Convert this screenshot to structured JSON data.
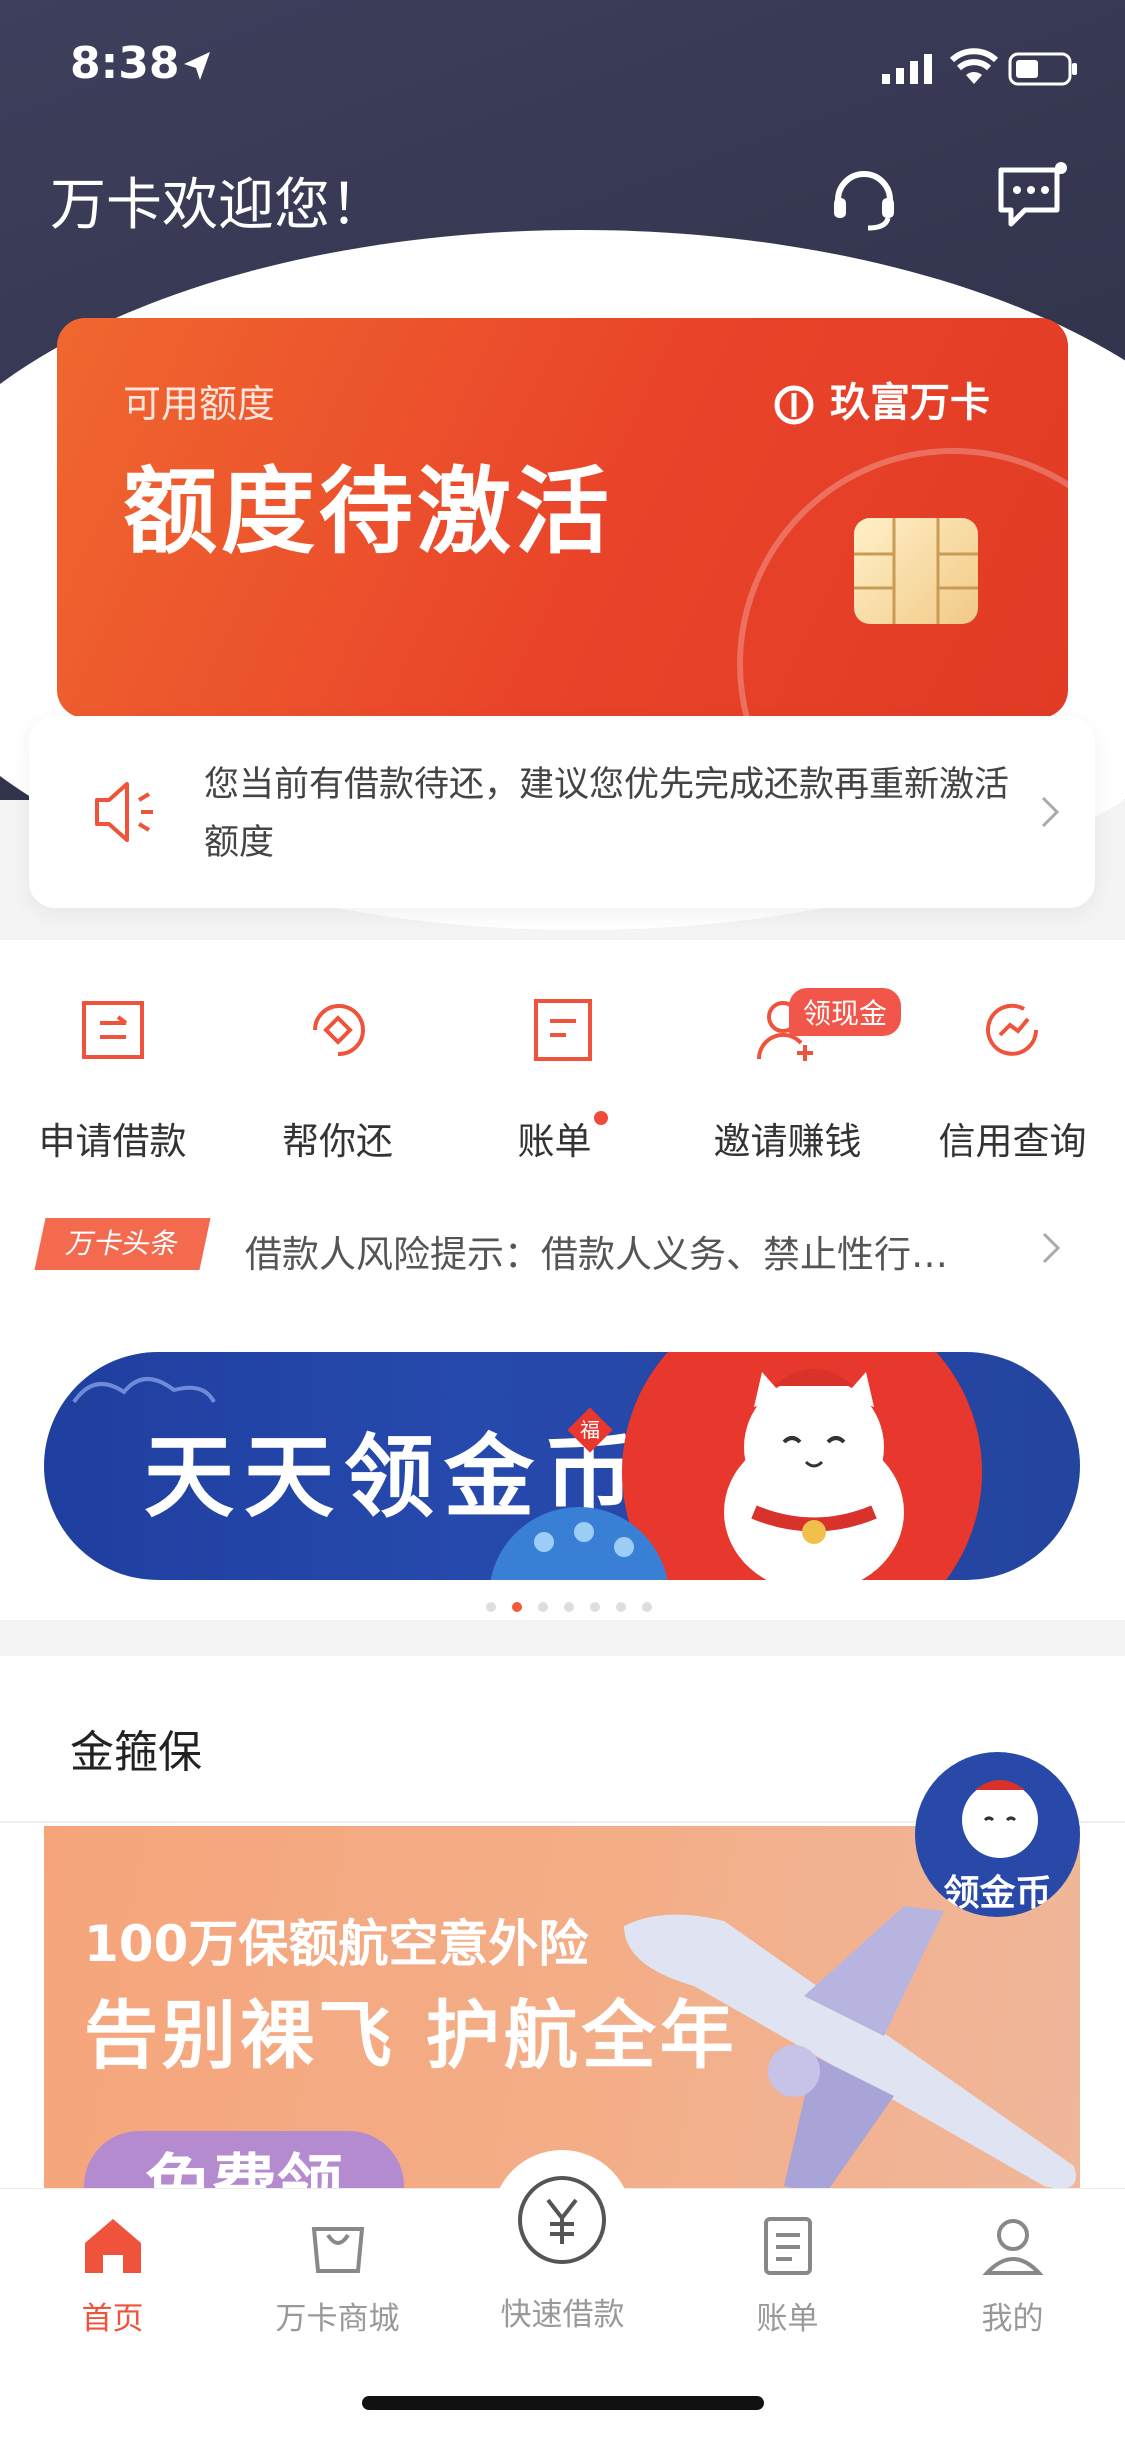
{
  "status_bar": {
    "time": "8:38"
  },
  "header": {
    "greeting": "万卡欢迎您！"
  },
  "card": {
    "label": "可用额度",
    "title": "额度待激活",
    "brand": "玖富万卡"
  },
  "notice": {
    "text": "您当前有借款待还，建议您优先完成还款再重新激活额度"
  },
  "services": [
    {
      "label": "申请借款",
      "icon": "loan-apply-icon"
    },
    {
      "label": "帮你还",
      "icon": "repay-help-icon"
    },
    {
      "label": "账单",
      "icon": "bill-icon"
    },
    {
      "label": "邀请赚钱",
      "icon": "invite-user-icon"
    },
    {
      "label": "信用查询",
      "icon": "credit-check-icon"
    }
  ],
  "invite_tag": "领现金",
  "headline": {
    "tag": "万卡头条",
    "text": "借款人风险提示：借款人义务、禁止性行…"
  },
  "banner": {
    "title": "天天领金币",
    "fu": "福"
  },
  "insurance": {
    "section_title": "金箍保",
    "line1": "100万保额航空意外险",
    "line2": "告别裸飞 护航全年",
    "button": "免费领"
  },
  "float_badge": {
    "text": "领金币"
  },
  "tabbar": [
    {
      "label": "首页",
      "active": true
    },
    {
      "label": "万卡商城",
      "active": false
    },
    {
      "label": "快速借款",
      "active": false
    },
    {
      "label": "账单",
      "active": false
    },
    {
      "label": "我的",
      "active": false
    }
  ],
  "colors": {
    "accent": "#f0533b",
    "header_bg": "#3a3b57",
    "card_red": "#e9432a"
  }
}
